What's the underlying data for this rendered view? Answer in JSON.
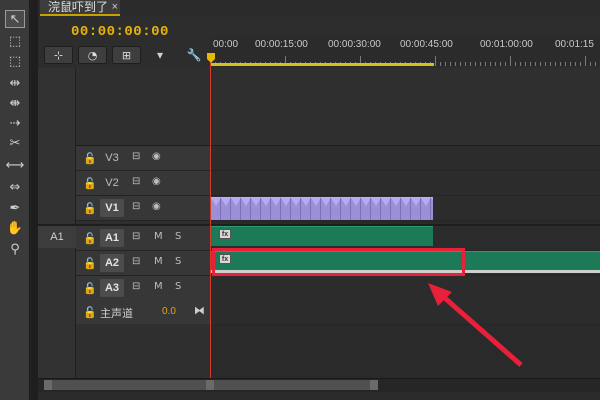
{
  "tab": {
    "title": "浣鼠吓到了",
    "close": "×"
  },
  "timecode": "00:00:00:00",
  "ruler": {
    "labels": [
      "00:00",
      "00:00:15:00",
      "00:00:30:00",
      "00:00:45:00",
      "00:01:00:00",
      "00:01:15"
    ]
  },
  "toolbar_icons": [
    "selection-tool-icon",
    "track-select-icon",
    "ripple-edit-icon",
    "rolling-edit-icon",
    "rate-stretch-icon",
    "razor-icon",
    "slip-icon",
    "slide-icon",
    "pen-icon",
    "hand-icon",
    "zoom-icon"
  ],
  "header_buttons": [
    "snap-button",
    "link-button",
    "add-marker-button"
  ],
  "video_tracks": [
    {
      "name": "V3",
      "active": false
    },
    {
      "name": "V2",
      "active": false
    },
    {
      "name": "V1",
      "active": true
    }
  ],
  "audio_tracks": [
    {
      "name": "A1",
      "active": true,
      "mute": "M",
      "solo": "S"
    },
    {
      "name": "A2",
      "active": true,
      "mute": "M",
      "solo": "S"
    },
    {
      "name": "A3",
      "active": true,
      "mute": "M",
      "solo": "S"
    }
  ],
  "source_patch": "A1",
  "master": {
    "label": "主声道",
    "value": "0.0"
  },
  "fx_label": "fx",
  "colors": {
    "accent": "#e8b30a",
    "video_clip": "#9b8fd6",
    "audio_clip": "#1d7a57",
    "highlight": "#e8203a",
    "playhead": "#d83a2a"
  }
}
